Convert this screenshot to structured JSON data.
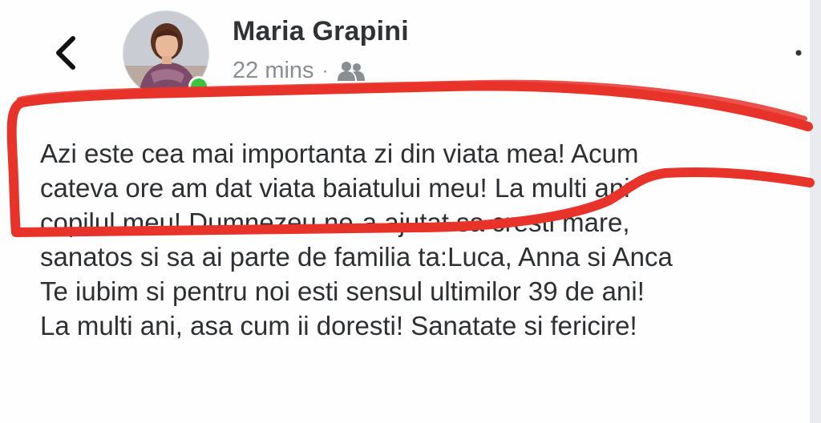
{
  "header": {
    "back_icon": "chevron-left-icon",
    "author_name": "Maria Grapini",
    "timestamp": "22 mins",
    "separator": "·",
    "audience_icon": "friends-icon",
    "more_icon": "more-options-icon",
    "online_status_color": "#3cc23c"
  },
  "post": {
    "lines": [
      "Azi este cea mai importanta zi din viata mea! Acum",
      "cateva ore am dat viata baiatului meu! La multi ani",
      "copilul meu! Dumnezeu ne-a ajutat sa cresti mare,",
      "sanatos si sa ai parte de familia ta:Luca, Anna si Anca",
      "Te iubim si pentru noi esti sensul ultimilor 39 de ani!",
      "La multi ani, asa cum ii doresti! Sanatate si fericire!"
    ]
  },
  "annotation": {
    "color": "#e8332a",
    "shape": "freehand-outline"
  }
}
